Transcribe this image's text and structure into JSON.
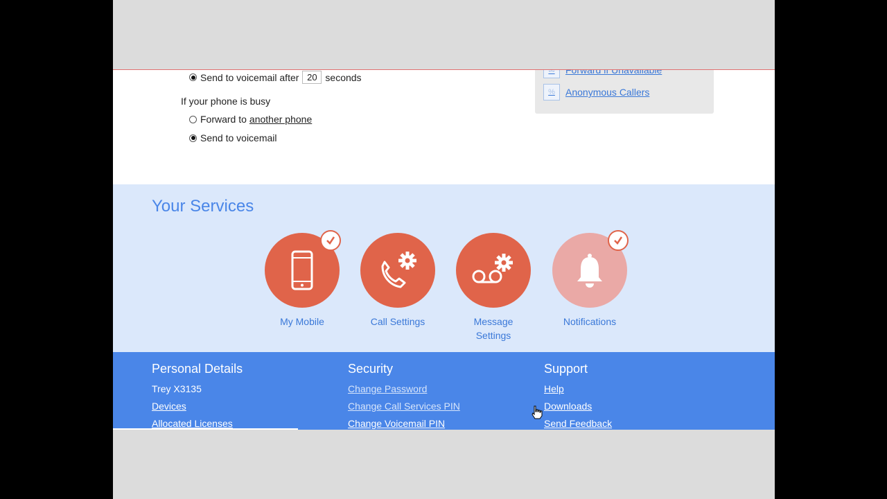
{
  "call_forwarding": {
    "unanswered_option_label": "Send to voicemail after",
    "seconds_value": "20",
    "seconds_label": "seconds",
    "busy_heading": "If your phone is busy",
    "busy_forward_prefix": "Forward to",
    "busy_forward_link": "another phone",
    "busy_voicemail_label": "Send to voicemail"
  },
  "side_panel": {
    "links": [
      "Forward if Unavailable",
      "Anonymous Callers"
    ]
  },
  "services": {
    "title": "Your Services",
    "items": [
      {
        "label": "My Mobile",
        "icon": "mobile-phone-icon",
        "checked": true
      },
      {
        "label": "Call Settings",
        "icon": "phone-gear-icon",
        "checked": false
      },
      {
        "label_line1": "Message",
        "label_line2": "Settings",
        "icon": "voicemail-gear-icon",
        "checked": false
      },
      {
        "label": "Notifications",
        "icon": "bell-icon",
        "checked": true
      }
    ]
  },
  "footer": {
    "personal": {
      "title": "Personal Details",
      "items": [
        "Trey X3135",
        "Devices",
        "Allocated Licenses"
      ]
    },
    "security": {
      "title": "Security",
      "items": [
        "Change Password",
        "Change Call Services PIN",
        "Change Voicemail PIN"
      ]
    },
    "support": {
      "title": "Support",
      "items": [
        "Help",
        "Downloads",
        "Send Feedback"
      ]
    }
  },
  "colors": {
    "accent_blue": "#4a86e8",
    "services_bg": "#dbe8fb",
    "service_circle": "#e0644a",
    "service_circle_disabled": "#eaa9a6"
  }
}
